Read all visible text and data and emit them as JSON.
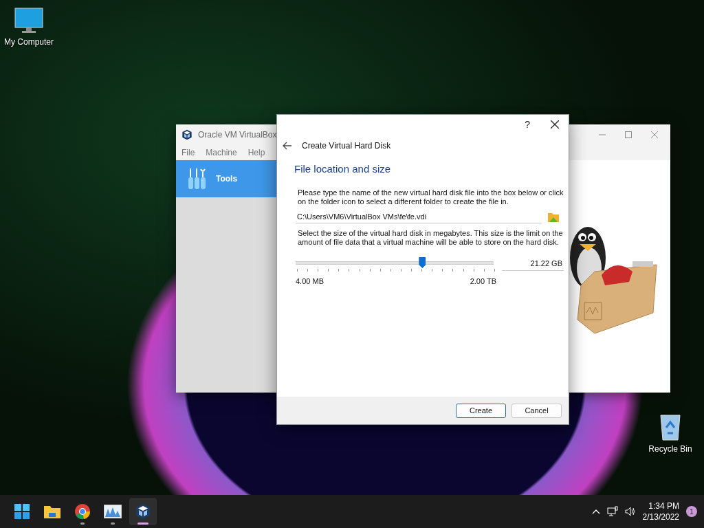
{
  "desktop_icons": [
    {
      "kind": "computer",
      "label": "My Computer"
    },
    {
      "kind": "recycle",
      "label": "Recycle Bin"
    }
  ],
  "main_window": {
    "title": "Oracle VM VirtualBox",
    "menu": [
      "File",
      "Machine",
      "Help"
    ],
    "sidebar_items": [
      {
        "label": "Tools",
        "selected": true
      }
    ]
  },
  "dialog": {
    "help": "?",
    "title": "Create Virtual Hard Disk",
    "heading": "File location and size",
    "location_description": "Please type the name of the new virtual hard disk file into the box below or click on the folder icon to select a different folder to create the file in.",
    "file_path": "C:\\Users\\VM6\\VirtualBox VMs\\fe\\fe.vdi",
    "size_description": "Select the size of the virtual hard disk in megabytes. This size is the limit on the amount of file data that a virtual machine will be able to store on the hard disk.",
    "size_slider": {
      "level": 0.64
    },
    "size_value": "21.22 GB",
    "min_label": "4.00 MB",
    "max_label": "2.00 TB",
    "buttons": [
      {
        "label": "Create",
        "default": true
      },
      {
        "label": "Cancel",
        "default": false
      }
    ]
  },
  "taskbar": {
    "apps": [
      {
        "kind": "start",
        "running": false,
        "selected": false
      },
      {
        "kind": "folder",
        "running": false,
        "selected": false
      },
      {
        "kind": "browser",
        "running": true,
        "selected": false
      },
      {
        "kind": "monitor",
        "running": true,
        "selected": false
      },
      {
        "kind": "virtualbox",
        "running": true,
        "selected": true
      }
    ],
    "time": "1:34 PM",
    "date": "2/13/2022",
    "notification_count": "1"
  }
}
